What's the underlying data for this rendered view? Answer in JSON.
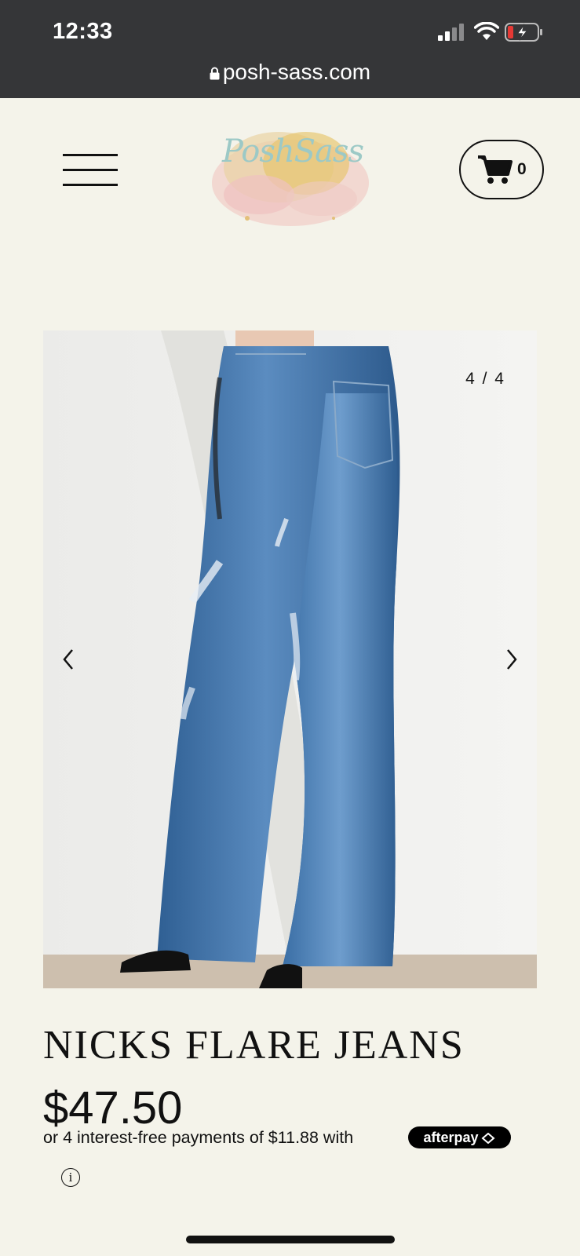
{
  "status_bar": {
    "time": "12:33",
    "url": "posh-sass.com"
  },
  "header": {
    "logo_text": "PoshSass",
    "cart_count": "0"
  },
  "gallery": {
    "counter": "4 / 4"
  },
  "product": {
    "title": "NICKS FLARE JEANS",
    "price": "$47.50",
    "installments_text": "or 4 interest-free payments of $11.88 with",
    "afterpay_label": "afterpay",
    "info_glyph": "i"
  },
  "colors": {
    "page_background": "#f4f3ea",
    "status_bar": "#353638",
    "text": "#111111"
  }
}
